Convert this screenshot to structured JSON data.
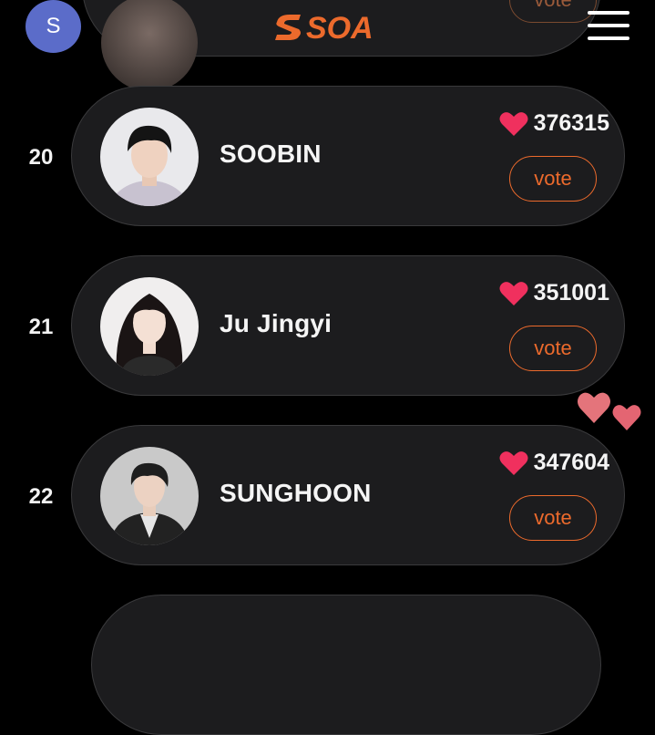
{
  "header": {
    "user_initial": "S",
    "logo_text": "SOA",
    "brand_color": "#ec6a2c"
  },
  "top_card": {
    "vote_label": "vote"
  },
  "ranking": [
    {
      "rank": "20",
      "name": "SOOBIN",
      "hearts": "376315",
      "vote_label": "vote"
    },
    {
      "rank": "21",
      "name": "Ju Jingyi",
      "hearts": "351001",
      "vote_label": "vote"
    },
    {
      "rank": "22",
      "name": "SUNGHOON",
      "hearts": "347604",
      "vote_label": "vote"
    }
  ],
  "icons": {
    "heart": "heart-icon",
    "menu": "hamburger-menu-icon",
    "floating": "floating-hearts-icon"
  },
  "colors": {
    "heart": "#f0305e",
    "card_bg": "#1c1c1e",
    "vote": "#ec6a2c"
  }
}
